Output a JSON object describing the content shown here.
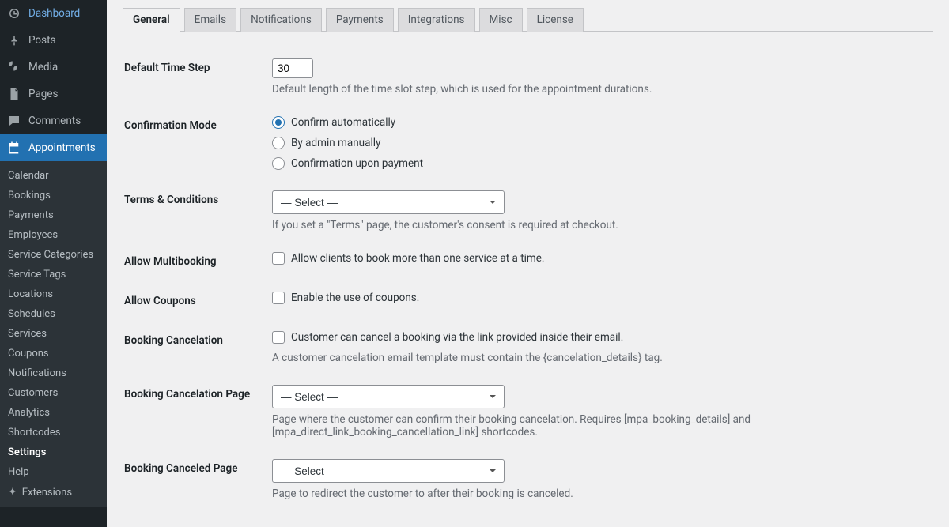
{
  "sidebar": {
    "main": [
      {
        "icon": "dashboard",
        "label": "Dashboard"
      },
      {
        "icon": "pin",
        "label": "Posts"
      },
      {
        "icon": "media",
        "label": "Media"
      },
      {
        "icon": "page",
        "label": "Pages"
      },
      {
        "icon": "comment",
        "label": "Comments"
      },
      {
        "icon": "calendar",
        "label": "Appointments",
        "current": true
      }
    ],
    "submenu": [
      {
        "label": "Calendar"
      },
      {
        "label": "Bookings"
      },
      {
        "label": "Payments"
      },
      {
        "label": "Employees"
      },
      {
        "label": "Service Categories"
      },
      {
        "label": "Service Tags"
      },
      {
        "label": "Locations"
      },
      {
        "label": "Schedules"
      },
      {
        "label": "Services"
      },
      {
        "label": "Coupons"
      },
      {
        "label": "Notifications"
      },
      {
        "label": "Customers"
      },
      {
        "label": "Analytics"
      },
      {
        "label": "Shortcodes"
      },
      {
        "label": "Settings",
        "current": true
      },
      {
        "label": "Help"
      },
      {
        "label": "Extensions",
        "ext": true
      }
    ]
  },
  "tabs": [
    "General",
    "Emails",
    "Notifications",
    "Payments",
    "Integrations",
    "Misc",
    "License"
  ],
  "fields": {
    "time_step": {
      "label": "Default Time Step",
      "value": "30",
      "desc": "Default length of the time slot step, which is used for the appointment durations."
    },
    "confirm": {
      "label": "Confirmation Mode",
      "opt1": "Confirm automatically",
      "opt2": "By admin manually",
      "opt3": "Confirmation upon payment"
    },
    "terms": {
      "label": "Terms & Conditions",
      "placeholder": "— Select —",
      "desc": "If you set a \"Terms\" page, the customer's consent is required at checkout."
    },
    "multi": {
      "label": "Allow Multibooking",
      "check": "Allow clients to book more than one service at a time."
    },
    "coupons": {
      "label": "Allow Coupons",
      "check": "Enable the use of coupons."
    },
    "cancel": {
      "label": "Booking Cancelation",
      "check": "Customer can cancel a booking via the link provided inside their email.",
      "desc": "A customer cancelation email template must contain the {cancelation_details} tag."
    },
    "cancel_page": {
      "label": "Booking Cancelation Page",
      "placeholder": "— Select —",
      "desc": "Page where the customer can confirm their booking cancelation. Requires [mpa_booking_details] and [mpa_direct_link_booking_cancellation_link] shortcodes."
    },
    "canceled_page": {
      "label": "Booking Canceled Page",
      "placeholder": "— Select —",
      "desc": "Page to redirect the customer to after their booking is canceled."
    }
  }
}
